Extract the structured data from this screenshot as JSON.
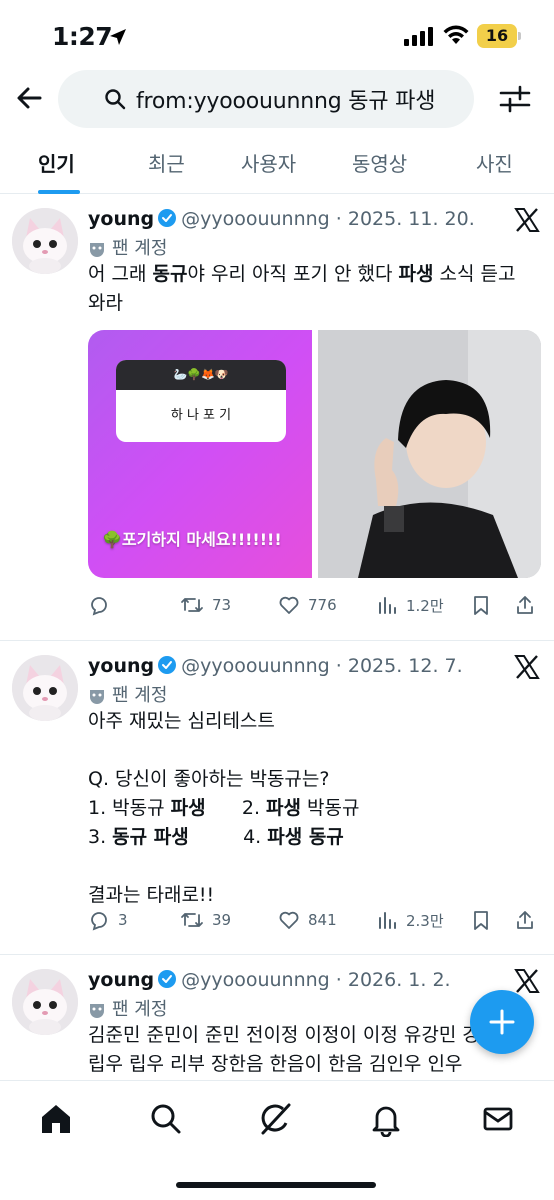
{
  "status_bar": {
    "time": "1:27",
    "battery": "16"
  },
  "search": {
    "query": "from:yyooouunnng 동규 파생"
  },
  "tabs": [
    {
      "label": "인기",
      "active": true
    },
    {
      "label": "최근",
      "active": false
    },
    {
      "label": "사용자",
      "active": false
    },
    {
      "label": "동영상",
      "active": false
    },
    {
      "label": "사진",
      "active": false
    }
  ],
  "tweets": [
    {
      "name": "young",
      "handle": "@yyooouunnng",
      "date": "· 2025. 11. 20.",
      "label": "팬 계정",
      "text_html": "어 그래 <b>동규</b>야 우리 아직 포기 안 했다 <b>파생</b> 소식 듣고 와라",
      "media": {
        "story_icons": "🦢🌳🦊🐶",
        "story_answer": "하 나 포 기",
        "caption": "🌳포기하지 마세요!!!!!!!"
      },
      "replies": "",
      "retweets": "73",
      "likes": "776",
      "views": "1.2만"
    },
    {
      "name": "young",
      "handle": "@yyooouunnng",
      "date": "· 2025. 12. 7.",
      "label": "팬 계정",
      "text_html": "아주 재밌는 심리테스트\n\nQ. 당신이 좋아하는 박동규는?\n1. 박동규 <b>파생</b>      2. <b>파생</b> 박동규\n3. <b>동규 파생</b>         4. <b>파생 동규</b>\n\n결과는 타래로!!",
      "replies": "3",
      "retweets": "39",
      "likes": "841",
      "views": "2.3만"
    },
    {
      "name": "young",
      "handle": "@yyooouunnng",
      "date": "· 2026. 1. 2.",
      "label": "팬 계정",
      "text_html": "김준민 준민이 준민 전이정 이정이 이정 유강민 강민 최립우 립우 리부 장한음 한음이 한음 김인우 인우"
    }
  ],
  "colors": {
    "accent": "#1d9bf0",
    "text": "#0f1419",
    "muted": "#536471"
  }
}
